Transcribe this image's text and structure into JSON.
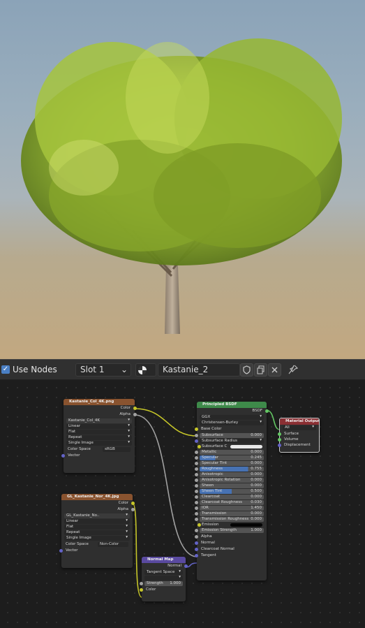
{
  "header": {
    "use_nodes_label": "Use Nodes",
    "slot": "Slot 1",
    "material_name": "Kastanie_2"
  },
  "nodes": {
    "tex_color": {
      "title": "Kastanie_Col_4K.png",
      "outputs": [
        "Color",
        "Alpha"
      ],
      "image": "Kastanie_Col_4K",
      "interpolation": "Linear",
      "projection": "Flat",
      "extension": "Repeat",
      "source": "Single Image",
      "color_space_label": "Color Space",
      "color_space": "sRGB",
      "vector": "Vector"
    },
    "tex_normal": {
      "title": "GL_Kastanie_Nor_4K.jpg",
      "outputs": [
        "Color",
        "Alpha"
      ],
      "image": "GL_Kastanie_No..",
      "interpolation": "Linear",
      "projection": "Flat",
      "extension": "Repeat",
      "source": "Single Image",
      "color_space_label": "Color Space",
      "color_space": "Non-Color",
      "vector": "Vector"
    },
    "bsdf": {
      "title": "Principled BSDF",
      "output": "BSDF",
      "distribution": "GGX",
      "subsurface_method": "Christensen-Burley",
      "base_color": "Base Color",
      "rows": [
        {
          "label": "Subsurface",
          "value": "0.000"
        },
        {
          "label": "Subsurface Radius",
          "value": ""
        },
        {
          "label": "Subsurface C",
          "value": ""
        },
        {
          "label": "Metallic",
          "value": "0.000"
        },
        {
          "label": "Specular",
          "value": "0.245"
        },
        {
          "label": "Specular Tint",
          "value": "0.000"
        },
        {
          "label": "Roughness",
          "value": "0.755"
        },
        {
          "label": "Anisotropic",
          "value": "0.000"
        },
        {
          "label": "Anisotropic Rotation",
          "value": "0.000"
        },
        {
          "label": "Sheen",
          "value": "0.000"
        },
        {
          "label": "Sheen Tint",
          "value": "0.500"
        },
        {
          "label": "Clearcoat",
          "value": "0.000"
        },
        {
          "label": "Clearcoat Roughness",
          "value": "0.030"
        },
        {
          "label": "IOR",
          "value": "1.450"
        },
        {
          "label": "Transmission",
          "value": "0.000"
        },
        {
          "label": "Transmission Roughness",
          "value": "0.000"
        },
        {
          "label": "Emission",
          "value": ""
        },
        {
          "label": "Emission Strength",
          "value": "1.000"
        }
      ],
      "inputs": [
        "Alpha",
        "Normal",
        "Clearcoat Normal",
        "Tangent"
      ]
    },
    "output": {
      "title": "Material Output",
      "target": "All",
      "inputs": [
        "Surface",
        "Volume",
        "Displacement"
      ]
    },
    "normal_map": {
      "title": "Normal Map",
      "output": "Normal",
      "space": "Tangent Space",
      "strength_label": "Strength",
      "strength": "1.000",
      "color": "Color"
    }
  }
}
